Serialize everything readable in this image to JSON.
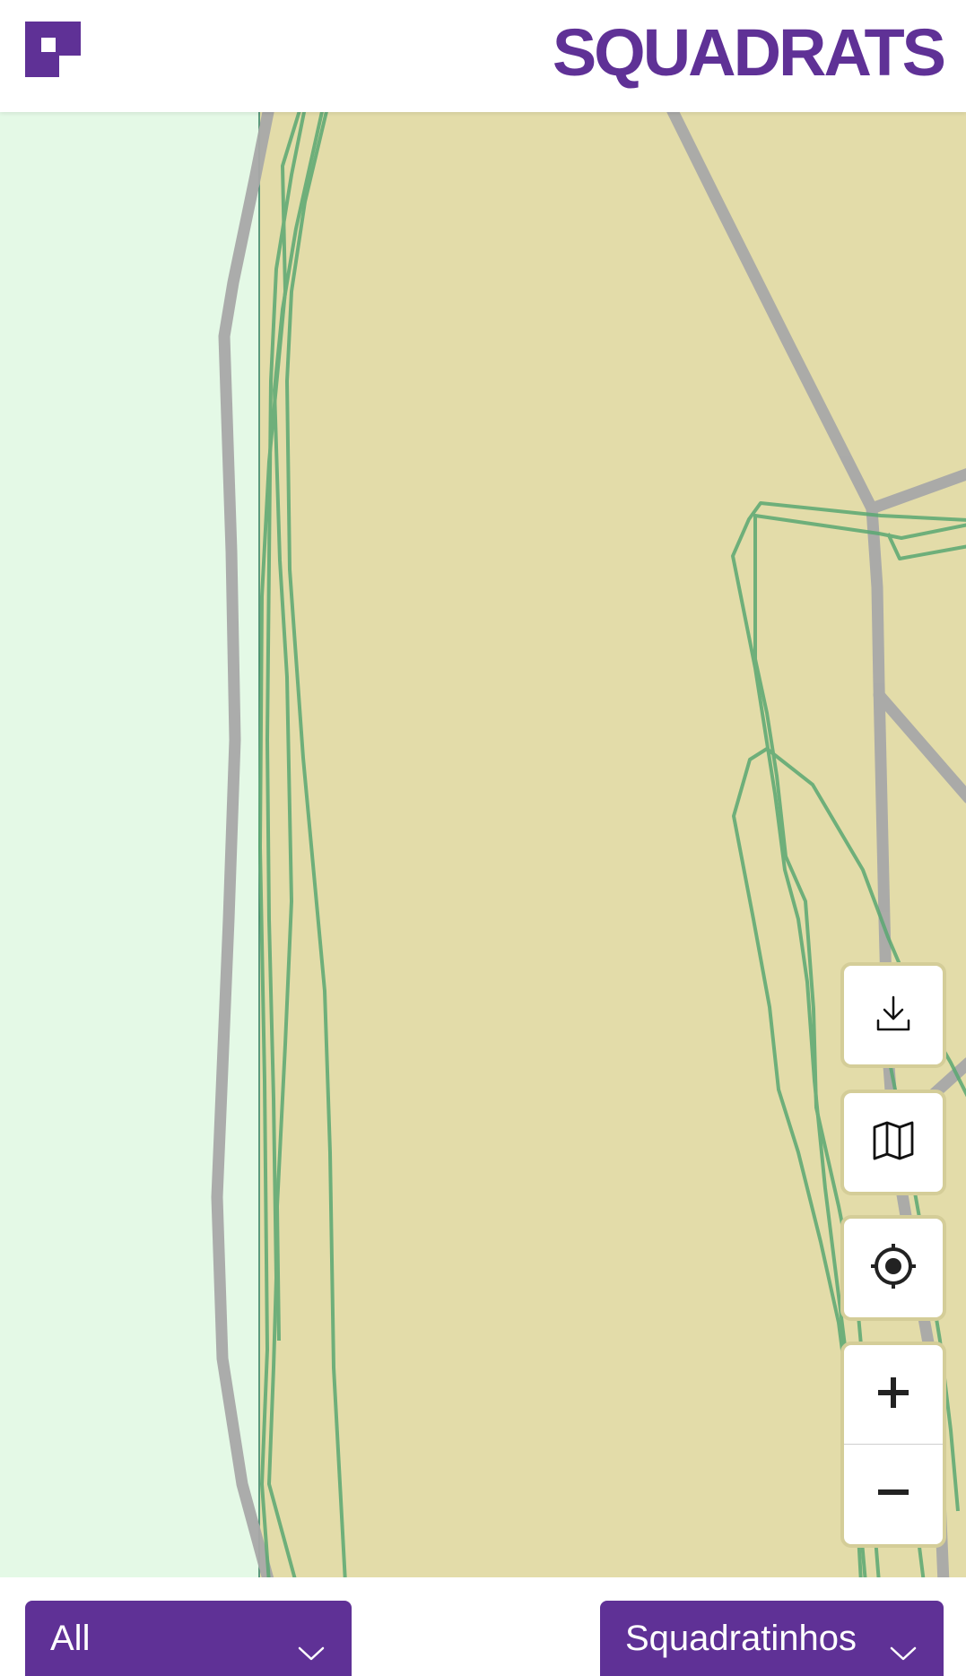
{
  "header": {
    "brand": "SQUADRATS",
    "logo_icon": "squadrats-logo-icon",
    "brand_color": "#5f3196"
  },
  "map": {
    "colors": {
      "visited_area": "#e3dca9",
      "unvisited_area": "#e4f9e6",
      "track": "#5aa872",
      "road": "#a8a8a8",
      "boundary": "#2f7a5a"
    }
  },
  "controls": {
    "download_icon": "download-icon",
    "layers_icon": "map-icon",
    "locate_icon": "locate-icon",
    "zoom_in_icon": "plus-icon",
    "zoom_out_icon": "minus-icon"
  },
  "filters": {
    "left": {
      "selected": "All"
    },
    "right": {
      "selected": "Squadratinhos"
    },
    "chevron_icon": "chevron-down-icon"
  }
}
